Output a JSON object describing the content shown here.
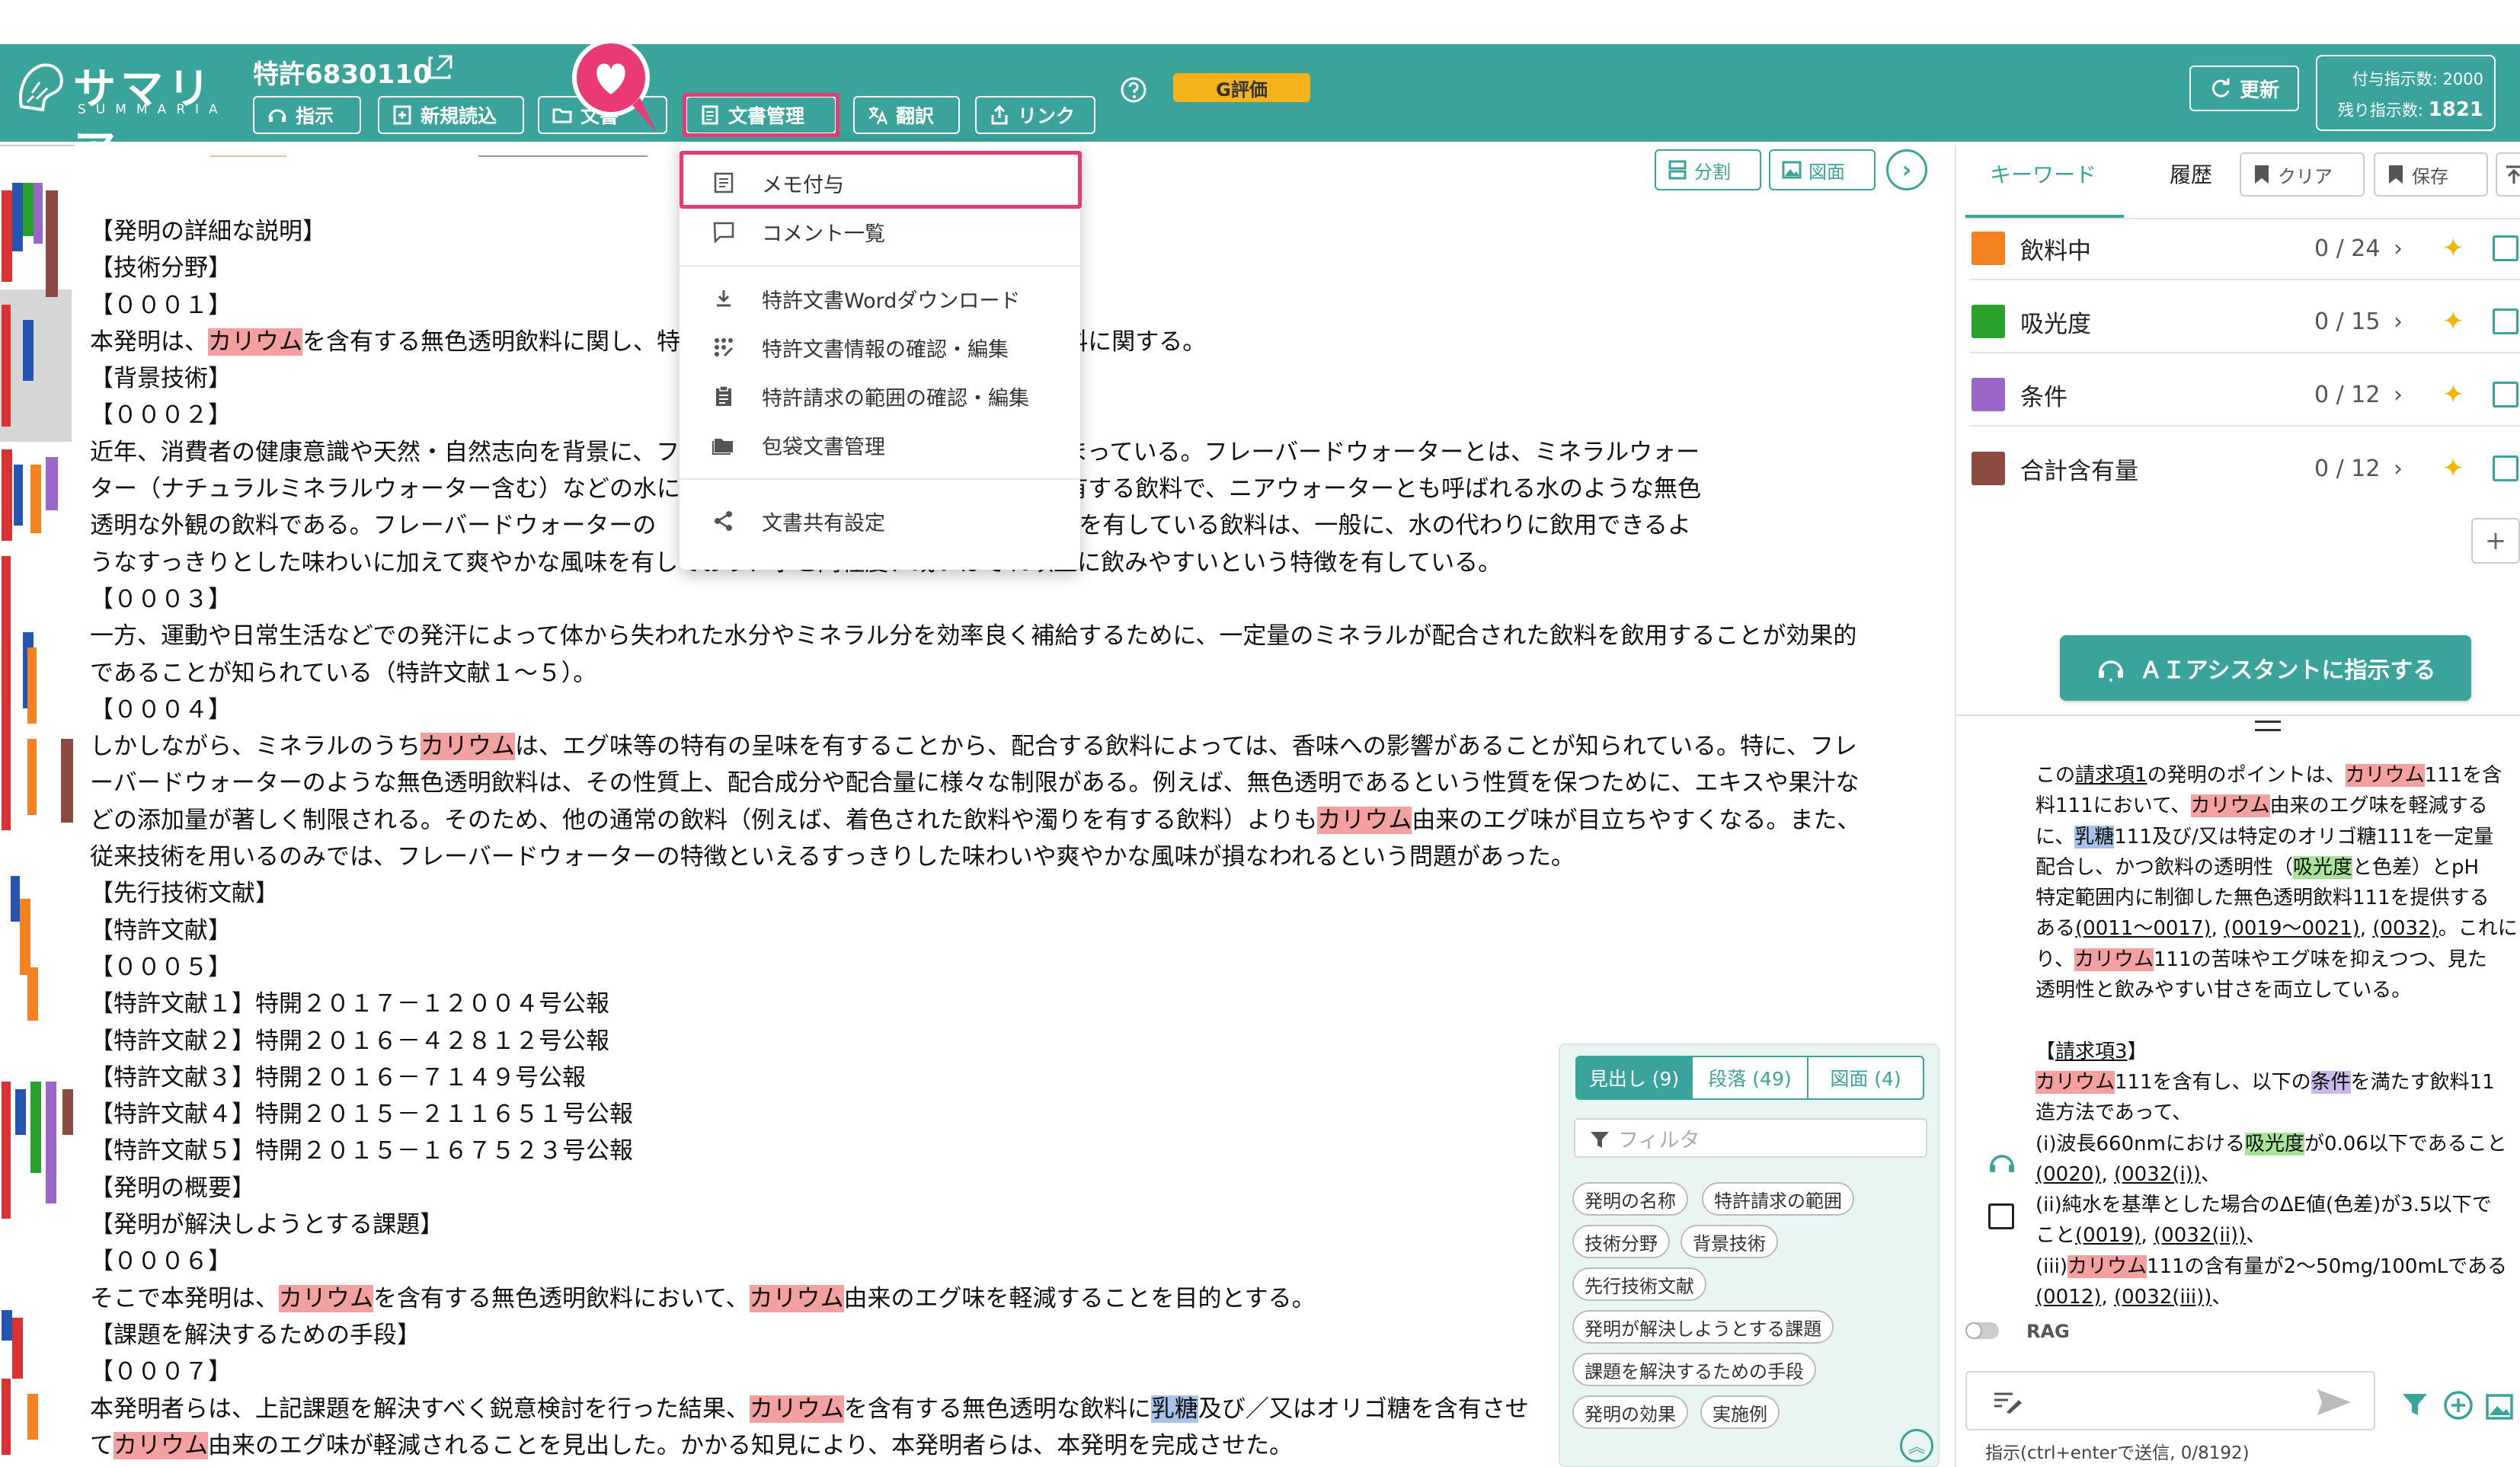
{
  "app": {
    "logo_text": "サマリア",
    "logo_sub": "SUMMARIA",
    "patent_title": "特許6830110",
    "grade_badge": "G評価"
  },
  "toolbar": {
    "instruct": "指示",
    "new_read": "新規読込",
    "doc_btn": "文書",
    "doc_mgmt": "文書管理",
    "translate": "翻訳",
    "link": "リンク"
  },
  "header_right": {
    "update": "更新",
    "quota_label": "付与指示数: 2000",
    "remaining_label": "残り指示数:",
    "remaining_value": "1821"
  },
  "doc_tools": {
    "split": "分割",
    "figure": "図面"
  },
  "menu": {
    "items": [
      {
        "label": "メモ付与",
        "icon": "memo-icon"
      },
      {
        "label": "コメント一覧",
        "icon": "comment-icon"
      },
      {
        "label": "特許文書Wordダウンロード",
        "icon": "download-icon"
      },
      {
        "label": "特許文書情報の確認・編集",
        "icon": "grid-icon"
      },
      {
        "label": "特許請求の範囲の確認・編集",
        "icon": "clipboard-icon"
      },
      {
        "label": "包袋文書管理",
        "icon": "folder-icon"
      },
      {
        "label": "文書共有設定",
        "icon": "share-icon"
      }
    ]
  },
  "document": {
    "lines": [
      [
        {
          "t": "【発明の詳細な説明】"
        }
      ],
      [
        {
          "t": "【技術分野】"
        }
      ],
      [
        {
          "t": "【０００１】"
        }
      ],
      [
        {
          "t": "本発明は、"
        },
        {
          "t": "カリウム",
          "h": "ka"
        },
        {
          "t": "を含有する無色透明飲料に関し、特"
        },
        {
          "t": "                          "
        },
        {
          "t": "された無色透明飲料に関する。"
        }
      ],
      [
        {
          "t": "【背景技術】"
        }
      ],
      [
        {
          "t": "【０００２】"
        }
      ],
      [
        {
          "t": "近年、消費者の健康意識や天然・自然志向を背景に、フ"
        },
        {
          "t": "                          "
        },
        {
          "t": "ater）の人気が高まっている。フレーバードウォーターとは、ミネラルウォー"
        }
      ],
      [
        {
          "t": "ター（ナチュラルミネラルウォーター含む）などの水に"
        },
        {
          "t": "                          "
        },
        {
          "t": "えた適度な甘味を有する飲料で、ニアウォーターとも呼ばれる水のような無色"
        }
      ],
      [
        {
          "t": "透明な外観の飲料である。フレーバードウォーターの"
        },
        {
          "t": "                            "
        },
        {
          "t": "の風味と適度な甘味を有している飲料は、一般に、水の代わりに飲用できるよ"
        }
      ],
      [
        {
          "t": "うなすっきりとした味わいに加えて爽やかな風味を有しており、水と同程度、或いはそれ以上に飲みやすいという特徴を有している。"
        }
      ],
      [
        {
          "t": "【０００３】"
        }
      ],
      [
        {
          "t": "一方、運動や日常生活などでの発汗によって体から失われた水分やミネラル分を効率良く補給するために、一定量のミネラルが配合された飲料を飲用することが効果的"
        }
      ],
      [
        {
          "t": "であることが知られている（特許文献１～５）。"
        }
      ],
      [
        {
          "t": "【０００４】"
        }
      ],
      [
        {
          "t": "しかしながら、ミネラルのうち"
        },
        {
          "t": "カリウム",
          "h": "ka"
        },
        {
          "t": "は、エグ味等の特有の呈味を有することから、配合する飲料によっては、香味への影響があることが知られている。特に、フレ"
        }
      ],
      [
        {
          "t": "ーバードウォーターのような無色透明飲料は、その性質上、配合成分や配合量に様々な制限がある。例えば、無色透明であるという性質を保つために、エキスや果汁な"
        }
      ],
      [
        {
          "t": "どの添加量が著しく制限される。そのため、他の通常の飲料（例えば、着色された飲料や濁りを有する飲料）よりも"
        },
        {
          "t": "カリウム",
          "h": "ka"
        },
        {
          "t": "由来のエグ味が目立ちやすくなる。また、"
        }
      ],
      [
        {
          "t": "従来技術を用いるのみでは、フレーバードウォーターの特徴といえるすっきりした味わいや爽やかな風味が損なわれるという問題があった。"
        }
      ],
      [
        {
          "t": "【先行技術文献】"
        }
      ],
      [
        {
          "t": "【特許文献】"
        }
      ],
      [
        {
          "t": "【０００５】"
        }
      ],
      [
        {
          "t": "【特許文献１】特開２０１７－１２００４号公報"
        }
      ],
      [
        {
          "t": "【特許文献２】特開２０１６－４２８１２号公報"
        }
      ],
      [
        {
          "t": "【特許文献３】特開２０１６－７１４９号公報"
        }
      ],
      [
        {
          "t": "【特許文献４】特開２０１５－２１１６５１号公報"
        }
      ],
      [
        {
          "t": "【特許文献５】特開２０１５－１６７５２３号公報"
        }
      ],
      [
        {
          "t": "【発明の概要】"
        }
      ],
      [
        {
          "t": "【発明が解決しようとする課題】"
        }
      ],
      [
        {
          "t": "【０００６】"
        }
      ],
      [
        {
          "t": "そこで本発明は、"
        },
        {
          "t": "カリウム",
          "h": "ka"
        },
        {
          "t": "を含有する無色透明飲料において、"
        },
        {
          "t": "カリウム",
          "h": "ka"
        },
        {
          "t": "由来のエグ味を軽減することを目的とする。"
        }
      ],
      [
        {
          "t": "【課題を解決するための手段】"
        }
      ],
      [
        {
          "t": "【０００７】"
        }
      ],
      [
        {
          "t": "本発明者らは、上記課題を解決すべく鋭意検討を行った結果、"
        },
        {
          "t": "カリウム",
          "h": "ka"
        },
        {
          "t": "を含有する無色透明な飲料に"
        },
        {
          "t": "乳糖",
          "h": "ny"
        },
        {
          "t": "及び／又はオリゴ糖を含有させ"
        }
      ],
      [
        {
          "t": "て"
        },
        {
          "t": "カリウム",
          "h": "ka"
        },
        {
          "t": "由来のエグ味が軽減されることを見出した。かかる知見により、本発明者らは、本発明を完成させた。"
        }
      ]
    ]
  },
  "right_panel": {
    "tab_keyword": "キーワード",
    "tab_history": "履歴",
    "clear": "クリア",
    "save": "保存",
    "keywords": [
      {
        "label": "飲料中",
        "count": "0 / 24",
        "color": "#f58220"
      },
      {
        "label": "吸光度",
        "count": "0 / 15",
        "color": "#2aa12a"
      },
      {
        "label": "条件",
        "count": "0 / 12",
        "color": "#9a66c8"
      },
      {
        "label": "合計含有量",
        "count": "0 / 12",
        "color": "#8b4a42"
      }
    ],
    "ai_button": "ＡＩアシスタントに指示する",
    "ai_lines": [
      [
        {
          "t": "この"
        },
        {
          "t": "請求項1",
          "u": 1
        },
        {
          "t": "の発明のポイントは、"
        },
        {
          "t": "カリウム",
          "h": "ka"
        },
        {
          "t": "111を含"
        }
      ],
      [
        {
          "t": "料111において、"
        },
        {
          "t": "カリウム",
          "h": "ka"
        },
        {
          "t": "由来のエグ味を軽減する"
        }
      ],
      [
        {
          "t": "に、"
        },
        {
          "t": "乳糖",
          "h": "ny"
        },
        {
          "t": "111及び/又は特定のオリゴ糖111を一定量"
        }
      ],
      [
        {
          "t": "配合し、かつ飲料の透明性（"
        },
        {
          "t": "吸光度",
          "h": "gr"
        },
        {
          "t": "と色差）とpH"
        }
      ],
      [
        {
          "t": "特定範囲内に制御した無色透明飲料111を提供する"
        }
      ],
      [
        {
          "t": "ある"
        },
        {
          "t": "(0011〜0017)",
          "u": 1
        },
        {
          "t": ", "
        },
        {
          "t": "(0019〜0021)",
          "u": 1
        },
        {
          "t": ", "
        },
        {
          "t": "(0032)",
          "u": 1
        },
        {
          "t": "。これに"
        }
      ],
      [
        {
          "t": "り、"
        },
        {
          "t": "カリウム",
          "h": "ka"
        },
        {
          "t": "111の苦味やエグ味を抑えつつ、見た"
        }
      ],
      [
        {
          "t": "透明性と飲みやすい甘さを両立している。"
        }
      ],
      [
        {
          "t": " "
        }
      ],
      [
        {
          "t": "【"
        },
        {
          "t": "請求項3",
          "u": 1
        },
        {
          "t": "】"
        }
      ],
      [
        {
          "t": "カリウム",
          "h": "ka"
        },
        {
          "t": "111を含有し、以下の"
        },
        {
          "t": "条件",
          "h": "pu"
        },
        {
          "t": "を満たす飲料11"
        }
      ],
      [
        {
          "t": "造方法であって、"
        }
      ],
      [
        {
          "t": "(i)波長660nmにおける"
        },
        {
          "t": "吸光度",
          "h": "gr"
        },
        {
          "t": "が0.06以下であること"
        }
      ],
      [
        {
          "t": "(0020)",
          "u": 1
        },
        {
          "t": ", "
        },
        {
          "t": "(0032(i))",
          "u": 1
        },
        {
          "t": "、"
        }
      ],
      [
        {
          "t": "(ii)純水を基準とした場合のΔE値(色差)が3.5以下で"
        }
      ],
      [
        {
          "t": "こと"
        },
        {
          "t": "(0019)",
          "u": 1
        },
        {
          "t": ", "
        },
        {
          "t": "(0032(ii))",
          "u": 1
        },
        {
          "t": "、"
        }
      ],
      [
        {
          "t": "(iii)"
        },
        {
          "t": "カリウム",
          "h": "ka"
        },
        {
          "t": "111の含有量が2〜50mg/100mLである"
        }
      ],
      [
        {
          "t": "(0012)",
          "u": 1
        },
        {
          "t": ", "
        },
        {
          "t": "(0032(iii))",
          "u": 1
        },
        {
          "t": "、"
        }
      ]
    ],
    "rag_label": "RAG",
    "chat_hint": "指示(ctrl+enterで送信, 0/8192)"
  },
  "nav_panel": {
    "tabs": [
      "見出し (9)",
      "段落 (49)",
      "図面 (4)"
    ],
    "filter_placeholder": "フィルタ",
    "chips": [
      "発明の名称",
      "特許請求の範囲",
      "技術分野",
      "背景技術",
      "先行技術文献",
      "発明が解決しようとする課題",
      "課題を解決するための手段",
      "発明の効果",
      "実施例"
    ]
  },
  "colors": {
    "accent": "#3aa39a",
    "highlight_red": "#ea3a76",
    "badge": "#f6b21a"
  }
}
